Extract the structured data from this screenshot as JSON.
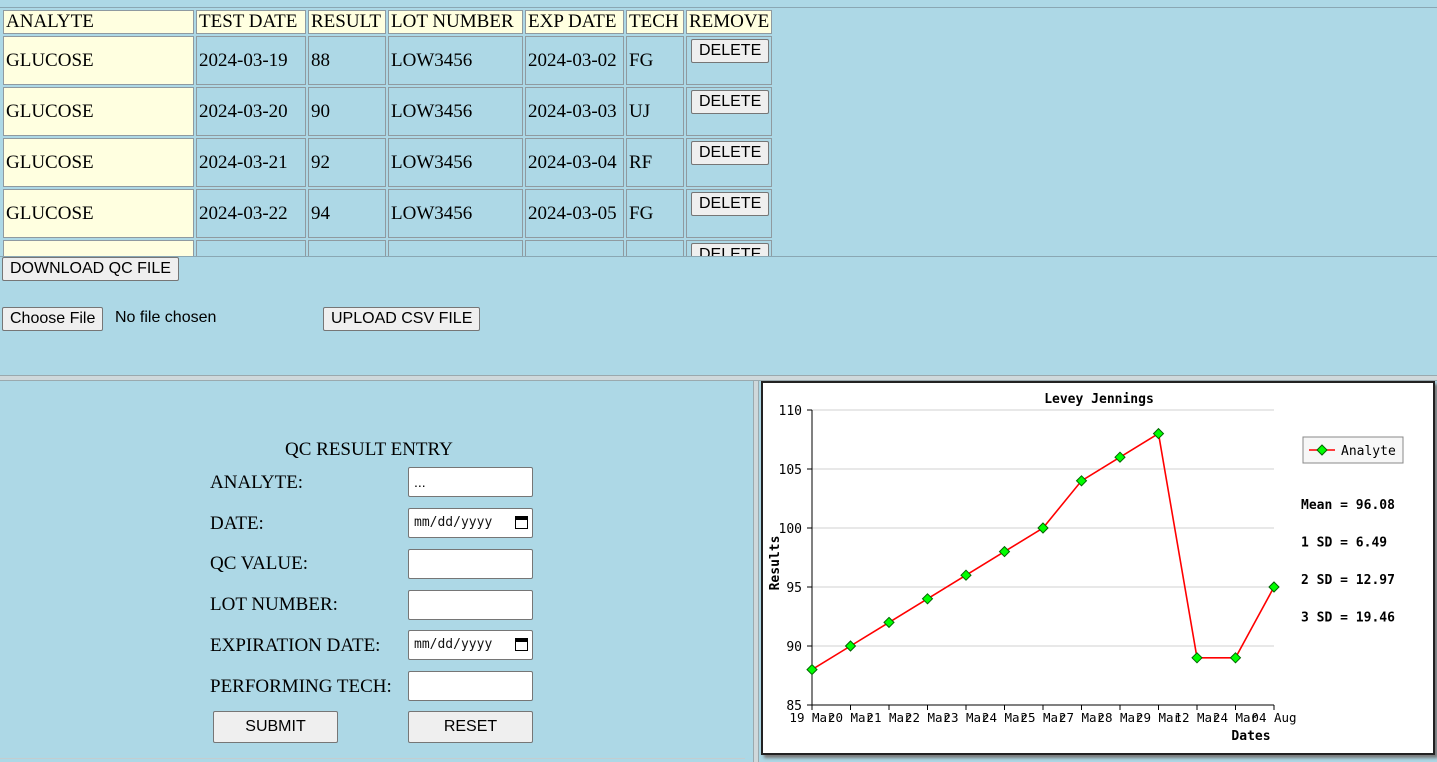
{
  "table": {
    "headers": [
      "ANALYTE",
      "TEST DATE",
      "RESULT",
      "LOT NUMBER",
      "EXP DATE",
      "TECH",
      "REMOVE"
    ],
    "rows": [
      {
        "analyte": "GLUCOSE",
        "test_date": "2024-03-19",
        "result": "88",
        "lot": "LOW3456",
        "exp": "2024-03-02",
        "tech": "FG",
        "remove": "DELETE"
      },
      {
        "analyte": "GLUCOSE",
        "test_date": "2024-03-20",
        "result": "90",
        "lot": "LOW3456",
        "exp": "2024-03-03",
        "tech": "UJ",
        "remove": "DELETE"
      },
      {
        "analyte": "GLUCOSE",
        "test_date": "2024-03-21",
        "result": "92",
        "lot": "LOW3456",
        "exp": "2024-03-04",
        "tech": "RF",
        "remove": "DELETE"
      },
      {
        "analyte": "GLUCOSE",
        "test_date": "2024-03-22",
        "result": "94",
        "lot": "LOW3456",
        "exp": "2024-03-05",
        "tech": "FG",
        "remove": "DELETE"
      },
      {
        "analyte": "",
        "test_date": "",
        "result": "",
        "lot": "",
        "exp": "",
        "tech": "",
        "remove": "DELETE"
      }
    ]
  },
  "file_actions": {
    "download_label": "DOWNLOAD QC FILE",
    "choose_label": "Choose File",
    "no_file_text": "No file chosen",
    "upload_label": "UPLOAD CSV FILE"
  },
  "form": {
    "title": "QC RESULT ENTRY",
    "analyte_label": "ANALYTE:",
    "analyte_value": "...",
    "date_label": "DATE:",
    "date_placeholder": "mm/dd/yyyy",
    "qc_value_label": "QC VALUE:",
    "lot_label": "LOT NUMBER:",
    "exp_label": "EXPIRATION DATE:",
    "exp_placeholder": "mm/dd/yyyy",
    "tech_label": "PERFORMING TECH:",
    "submit_label": "SUBMIT",
    "reset_label": "RESET"
  },
  "chart_data": {
    "type": "line",
    "title": "Levey Jennings",
    "xlabel": "Dates",
    "ylabel": "Results",
    "categories": [
      "19 Mar",
      "20 Mar",
      "21 Mar",
      "22 Mar",
      "23 Mar",
      "24 Mar",
      "25 Mar",
      "27 Mar",
      "28 Mar",
      "29 Mar",
      "12 Mar",
      "24 Mar",
      "04 Aug"
    ],
    "series": [
      {
        "name": "Analyte",
        "values": [
          88,
          90,
          92,
          94,
          96,
          98,
          100,
          104,
          106,
          108,
          89,
          89,
          95
        ],
        "color": "#ff0000",
        "marker_color": "#00ff00"
      }
    ],
    "ylim": [
      85,
      110
    ],
    "yticks": [
      85,
      90,
      95,
      100,
      105,
      110
    ],
    "grid": true,
    "legend": "right",
    "stats": [
      "Mean = 96.08",
      "1 SD = 6.49",
      "2 SD = 12.97",
      "3 SD = 19.46"
    ]
  }
}
